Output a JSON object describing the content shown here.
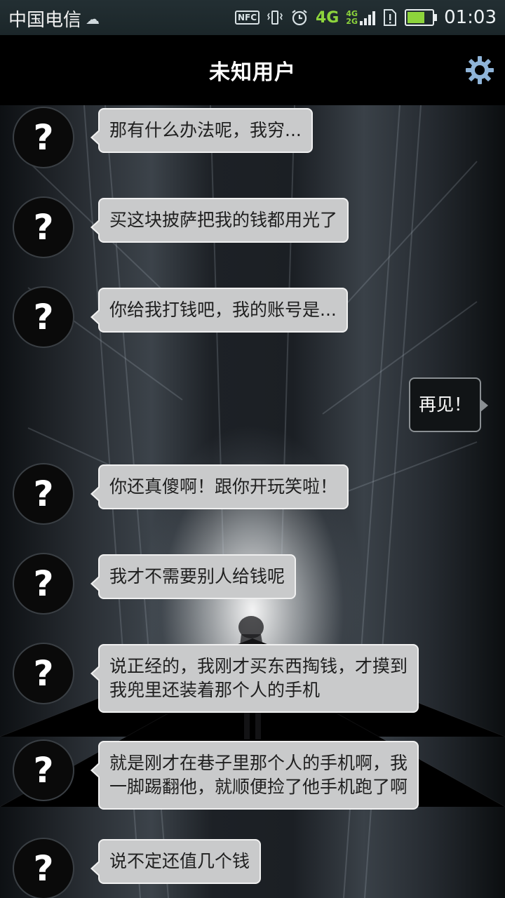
{
  "status_bar": {
    "carrier": "中国电信",
    "weather_icon": "cloud-icon",
    "nfc_label": "NFC",
    "network_4g": "4G",
    "network_small_top": "4G",
    "network_small_bottom": "2G",
    "battery_percent": 70,
    "time": "01:03"
  },
  "header": {
    "title": "未知用户",
    "settings_icon": "gear-icon"
  },
  "messages": [
    {
      "side": "in",
      "avatar": "?",
      "text": "那有什么办法呢，我穷..."
    },
    {
      "side": "in",
      "avatar": "?",
      "text": "买这块披萨把我的钱都用光了"
    },
    {
      "side": "in",
      "avatar": "?",
      "text": "你给我打钱吧，我的账号是..."
    },
    {
      "side": "out",
      "text": "再见！"
    },
    {
      "side": "in",
      "avatar": "?",
      "text": "你还真傻啊！跟你开玩笑啦！"
    },
    {
      "side": "in",
      "avatar": "?",
      "text": "我才不需要别人给钱呢"
    },
    {
      "side": "in",
      "avatar": "?",
      "text": "说正经的，我刚才买东西掏钱，才摸到\n我兜里还装着那个人的手机"
    },
    {
      "side": "in",
      "avatar": "?",
      "text": "就是刚才在巷子里那个人的手机啊，我\n一脚踢翻他，就顺便捡了他手机跑了啊"
    },
    {
      "side": "in",
      "avatar": "?",
      "text": "说不定还值几个钱"
    }
  ],
  "colors": {
    "header_bg": "#000000",
    "bubble_in_bg": "#c9cacb",
    "bubble_out_bg": "#111416",
    "accent_green": "#8dd43c",
    "gear_blue": "#8fb4d8"
  }
}
